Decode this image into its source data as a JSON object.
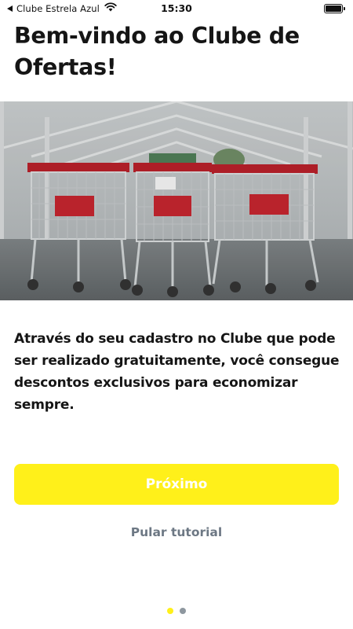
{
  "status_bar": {
    "carrier": "Clube Estrela Azul",
    "time": "15:30",
    "battery_level": 1.0
  },
  "welcome": {
    "title": "Bem-vindo ao Clube de Ofertas!",
    "hero_image": "shopping-carts-photo",
    "description": "Através do seu cadastro no Clube que pode ser realizado gratuitamente, você consegue descontos exclusivos para economizar sempre."
  },
  "actions": {
    "next_label": "Próximo",
    "skip_label": "Pular tutorial"
  },
  "pagination": {
    "total": 2,
    "active_index": 0
  },
  "colors": {
    "accent": "#fff01a",
    "text": "#151515",
    "muted": "#6d7884",
    "dot_inactive": "#8e979f"
  }
}
